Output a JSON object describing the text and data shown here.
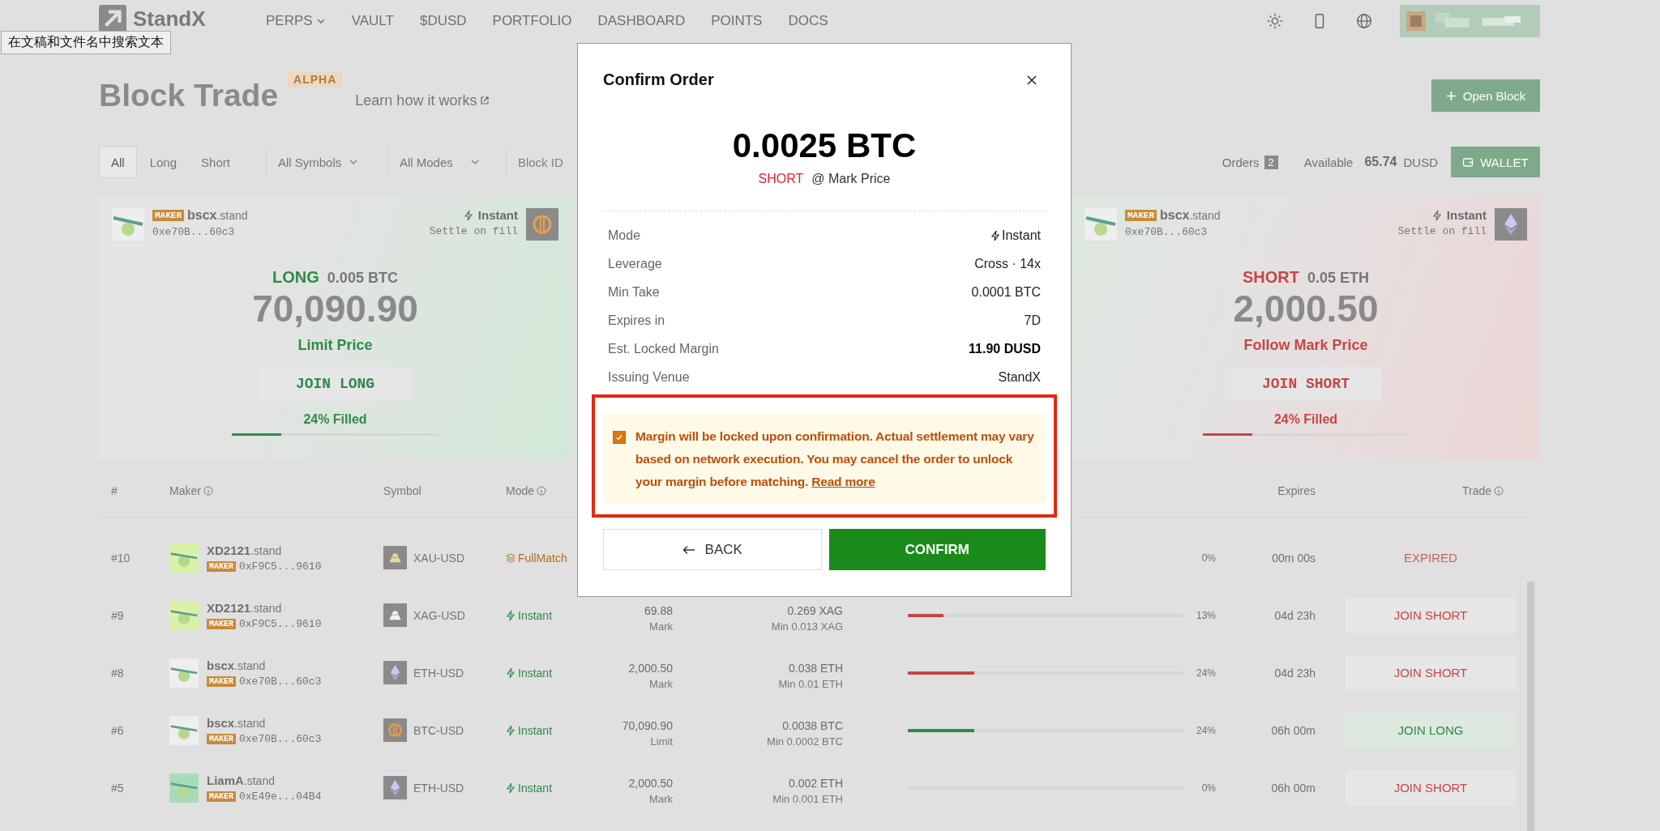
{
  "nav": {
    "logo": "StandX",
    "items": [
      {
        "label": "PERPS",
        "dropdown": true
      },
      {
        "label": "VAULT",
        "dropdown": false
      },
      {
        "label": "$DUSD",
        "dropdown": false
      },
      {
        "label": "PORTFOLIO",
        "dropdown": false
      },
      {
        "label": "DASHBOARD",
        "dropdown": false
      },
      {
        "label": "POINTS",
        "dropdown": false
      },
      {
        "label": "DOCS",
        "dropdown": false
      }
    ]
  },
  "tooltip": "在文稿和文件名中搜索文本",
  "header": {
    "title": "Block Trade",
    "badge": "ALPHA",
    "link": "Learn how it works",
    "button": "Open Block"
  },
  "filters": {
    "sides": [
      {
        "label": "All",
        "selected": true
      },
      {
        "label": "Long",
        "selected": false
      },
      {
        "label": "Short",
        "selected": false
      }
    ],
    "symbols": "All Symbols",
    "modes": "All Modes",
    "block_id": {
      "placeholder": "Block ID"
    },
    "orders_label": "Orders",
    "orders_count": "2",
    "available_label": "Available",
    "available_value": "65.74",
    "available_unit": "DUSD",
    "wallet": "WALLET"
  },
  "cards": [
    {
      "kind": "long",
      "color": "#eeeeee",
      "badge": "MAKER",
      "name": "bscx",
      "suffix": ".stand",
      "address": "0xe70B...60c3",
      "mode": "Instant",
      "settle": "Settle on fill",
      "coin": {
        "kind": "btc"
      },
      "side_label": "LONG",
      "size": "0.005 BTC",
      "price": "70,090.90",
      "price_type": "Limit Price",
      "button": "JOIN LONG",
      "filled": "24% Filled",
      "level": 0.24
    },
    {
      "kind": "short",
      "color": "#eeeeee",
      "badge": "MAKER",
      "name": "bscx",
      "suffix": ".stand",
      "address": "0xe70B...60c3",
      "mode": "Instant",
      "settle": "Settle on fill",
      "coin": {
        "kind": "eth"
      },
      "side_label": "SHORT",
      "size": "0.05 ETH",
      "price": "2,000.50",
      "price_type": "Follow Mark Price",
      "button": "JOIN SHORT",
      "filled": "24% Filled",
      "level": 0.24
    }
  ],
  "table": {
    "columns": [
      {
        "label": "#",
        "info": false
      },
      {
        "label": "Maker",
        "info": true
      },
      {
        "label": "Symbol",
        "info": false
      },
      {
        "label": "Mode",
        "info": true
      },
      {
        "label": "Expires",
        "info": false
      },
      {
        "label": "Trade",
        "info": true
      }
    ],
    "rows": [
      {
        "index": "#10",
        "color": "#d8f2a8",
        "name": "XD2121",
        "suffix": ".stand",
        "badge": "MAKER",
        "address": "0xF9C5...9610",
        "coin": {
          "kind": "xau"
        },
        "symbol": "XAU-USD",
        "mode": {
          "kind": "fullmatch",
          "label": "FullMatch"
        },
        "pct": "0%",
        "expires": "00m 00s",
        "trade": {
          "kind": "expired",
          "label": "EXPIRED"
        }
      },
      {
        "index": "#9",
        "color": "#d8f2a8",
        "name": "XD2121",
        "suffix": ".stand",
        "badge": "MAKER",
        "address": "0xF9C5...9610",
        "coin": {
          "kind": "xag"
        },
        "symbol": "XAG-USD",
        "mode": {
          "kind": "instant",
          "label": "Instant"
        },
        "price": "69.88",
        "price_type": "Mark",
        "amount": "0.269 XAG",
        "min": "Min 0.013 XAG",
        "level": 0.13,
        "pct": "13%",
        "expires": "04d 23h",
        "trade": {
          "kind": "short",
          "label": "JOIN SHORT"
        }
      },
      {
        "index": "#8",
        "color": "#eeeeee",
        "name": "bscx",
        "suffix": ".stand",
        "badge": "MAKER",
        "address": "0xe70B...60c3",
        "coin": {
          "kind": "eth"
        },
        "symbol": "ETH-USD",
        "mode": {
          "kind": "instant",
          "label": "Instant"
        },
        "price": "2,000.50",
        "price_type": "Mark",
        "amount": "0.038 ETH",
        "min": "Min 0.01 ETH",
        "level": 0.24,
        "pct": "24%",
        "expires": "04d 23h",
        "trade": {
          "kind": "short",
          "label": "JOIN SHORT"
        }
      },
      {
        "index": "#6",
        "color": "#eeeeee",
        "name": "bscx",
        "suffix": ".stand",
        "badge": "MAKER",
        "address": "0xe70B...60c3",
        "coin": {
          "kind": "btc"
        },
        "symbol": "BTC-USD",
        "mode": {
          "kind": "instant",
          "label": "Instant"
        },
        "price": "70,090.90",
        "price_type": "Limit",
        "amount": "0.0038 BTC",
        "min": "Min 0.0002 BTC",
        "level": 0.24,
        "pct": "24%",
        "expires": "06h 00m",
        "trade": {
          "kind": "long",
          "label": "JOIN LONG"
        }
      },
      {
        "index": "#5",
        "color": "#a8dcb8",
        "name": "LiamA",
        "suffix": ".stand",
        "badge": "MAKER",
        "address": "0xE49e...04B4",
        "coin": {
          "kind": "eth"
        },
        "symbol": "ETH-USD",
        "mode": {
          "kind": "instant",
          "label": "Instant"
        },
        "price": "2,000.50",
        "price_type": "Mark",
        "amount": "0.002 ETH",
        "min": "Min 0.001 ETH",
        "level": 0,
        "pct": "0%",
        "expires": "06h 00m",
        "trade": {
          "kind": "short",
          "label": "JOIN SHORT"
        }
      }
    ]
  },
  "modal": {
    "title": "Confirm Order",
    "amount": "0.0025 BTC",
    "side": {
      "kind": "short",
      "label": "SHORT"
    },
    "price_note": "@ Mark Price",
    "details": [
      {
        "label": "Mode",
        "value": "Instant",
        "kind": "mode"
      },
      {
        "label": "Leverage",
        "value": "Cross · 14x",
        "kind": "plain"
      },
      {
        "label": "Min Take",
        "value": "0.0001 BTC",
        "kind": "plain"
      },
      {
        "label": "Expires in",
        "value": "7D",
        "kind": "plain"
      },
      {
        "label": "Est. Locked Margin",
        "value": "11.90 DUSD",
        "kind": "bold"
      },
      {
        "label": "Issuing Venue",
        "value": "StandX",
        "kind": "plain"
      }
    ],
    "notice": {
      "checked": true,
      "highlighted": true,
      "text": "Margin will be locked upon confirmation. Actual settlement may vary based on network execution. You may cancel the order to unlock your margin before matching.",
      "link": "Read more"
    },
    "back": "BACK",
    "confirm": "CONFIRM"
  }
}
